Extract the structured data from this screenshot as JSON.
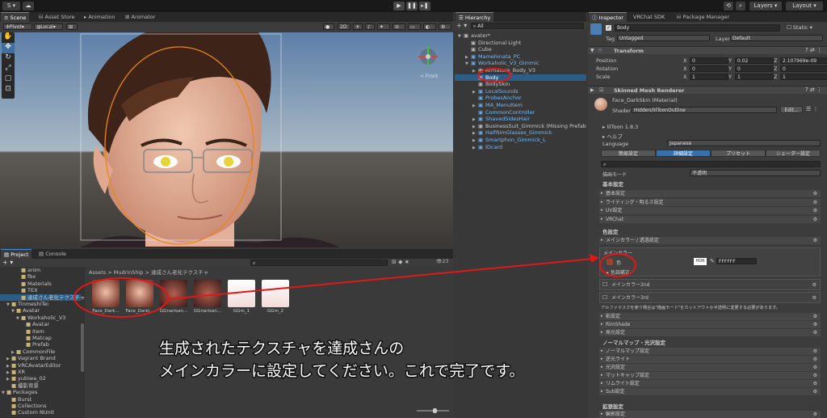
{
  "toolbar": {
    "account": "S",
    "layers": "Layers",
    "layout": "Layout"
  },
  "scene": {
    "tabs": [
      "Scene",
      "Asset Store",
      "Animation",
      "Animator"
    ],
    "pivot": "Pivot",
    "local": "Local",
    "mode2d": "2D",
    "front": "< Front"
  },
  "hierarchy": {
    "tab": "Hierarchy",
    "search": "All",
    "items": [
      {
        "label": "avater*",
        "indent": 0,
        "blue": false,
        "expand": "▼",
        "sel": false
      },
      {
        "label": "Directional Light",
        "indent": 1,
        "blue": false,
        "expand": "",
        "sel": false
      },
      {
        "label": "Cube",
        "indent": 1,
        "blue": false,
        "expand": "",
        "sel": false
      },
      {
        "label": "Mamehinata_PC",
        "indent": 1,
        "blue": true,
        "expand": "▶",
        "sel": false
      },
      {
        "label": "Workaholic_V3_Gimmic",
        "indent": 1,
        "blue": true,
        "expand": "▼",
        "sel": false
      },
      {
        "label": "Armature_Body_V3",
        "indent": 2,
        "blue": false,
        "expand": "▶",
        "sel": false
      },
      {
        "label": "Body",
        "indent": 2,
        "blue": false,
        "expand": "",
        "sel": true
      },
      {
        "label": "BodySkin",
        "indent": 2,
        "blue": false,
        "expand": "",
        "sel": false
      },
      {
        "label": "LocalSounds",
        "indent": 2,
        "blue": true,
        "expand": "▶",
        "sel": false
      },
      {
        "label": "ProbesAnchor",
        "indent": 2,
        "blue": true,
        "expand": "",
        "sel": false
      },
      {
        "label": "MA_MenuItem",
        "indent": 2,
        "blue": true,
        "expand": "▶",
        "sel": false
      },
      {
        "label": "CommonController",
        "indent": 2,
        "blue": true,
        "expand": "",
        "sel": false
      },
      {
        "label": "ShavedSidesHair",
        "indent": 2,
        "blue": true,
        "expand": "▶",
        "sel": false
      },
      {
        "label": "BusinessSuit_Gimmick (Missing Prefab",
        "indent": 2,
        "blue": false,
        "expand": "▶",
        "sel": false
      },
      {
        "label": "HalfRimGlasses_Gimmick",
        "indent": 2,
        "blue": true,
        "expand": "▶",
        "sel": false
      },
      {
        "label": "Smartphon_Gimmick_L",
        "indent": 2,
        "blue": true,
        "expand": "▶",
        "sel": false
      },
      {
        "label": "IDcard",
        "indent": 2,
        "blue": true,
        "expand": "▶",
        "sel": false
      }
    ]
  },
  "project": {
    "tabs": [
      "Project",
      "Console"
    ],
    "breadcrumb": [
      "Assets",
      "MudrinShip",
      "達成さん老化テクスチャ"
    ],
    "count": "23",
    "tree": [
      {
        "label": "anim",
        "indent": 3,
        "expand": ""
      },
      {
        "label": "fbx",
        "indent": 3,
        "expand": ""
      },
      {
        "label": "Materials",
        "indent": 3,
        "expand": ""
      },
      {
        "label": "TEX",
        "indent": 3,
        "expand": ""
      },
      {
        "label": "達成さん老化テクスチャ",
        "indent": 3,
        "expand": "",
        "sel": true
      },
      {
        "label": "TinmeshiTei",
        "indent": 1,
        "expand": "▼"
      },
      {
        "label": "Avatar",
        "indent": 2,
        "expand": "▼"
      },
      {
        "label": "Workaholic_V3",
        "indent": 3,
        "expand": "▼"
      },
      {
        "label": "Avatar",
        "indent": 4,
        "expand": ""
      },
      {
        "label": "Item",
        "indent": 4,
        "expand": ""
      },
      {
        "label": "Matcap",
        "indent": 4,
        "expand": ""
      },
      {
        "label": "Prefab",
        "indent": 4,
        "expand": ""
      },
      {
        "label": "CommonFile",
        "indent": 2,
        "expand": "▶"
      },
      {
        "label": "Vagrant Brand",
        "indent": 1,
        "expand": "▶"
      },
      {
        "label": "VRCAvatarEditor",
        "indent": 1,
        "expand": "▶"
      },
      {
        "label": "XR",
        "indent": 1,
        "expand": "▶"
      },
      {
        "label": "yubiwa_02",
        "indent": 1,
        "expand": "▶"
      },
      {
        "label": "撮影背景",
        "indent": 1,
        "expand": ""
      },
      {
        "label": "Packages",
        "indent": 0,
        "expand": "▼"
      },
      {
        "label": "Burst",
        "indent": 1,
        "expand": ""
      },
      {
        "label": "Collections",
        "indent": 1,
        "expand": ""
      },
      {
        "label": "Custom NUnit",
        "indent": 1,
        "expand": ""
      }
    ],
    "assets": [
      "Face_Dark...",
      "Face_Darki...",
      "GGnarisan...",
      "GGnarisan...",
      "GGm_1",
      "GGm_2"
    ]
  },
  "inspector": {
    "tabs": [
      "Inspector",
      "VRChat SDK",
      "Package Manager"
    ],
    "name": "Body",
    "static": "Static",
    "tag_label": "Tag",
    "tag": "Untagged",
    "layer_label": "Layer",
    "layer": "Default",
    "transform": {
      "title": "Transform",
      "rows": [
        {
          "label": "Position",
          "x": "0",
          "y": "0.02",
          "z": "2.107969e-09"
        },
        {
          "label": "Rotation",
          "x": "0",
          "y": "0",
          "z": "0"
        },
        {
          "label": "Scale",
          "x": "1",
          "y": "1",
          "z": "1"
        }
      ]
    },
    "smr": "Skinned Mesh Renderer",
    "material": "Face_DarkSkin (Material)",
    "shader_label": "Shader",
    "shader": "Hidden/lilToonOutline",
    "edit": "Edit...",
    "liltoon": "lilToon 1.8.3",
    "help": "ヘルプ",
    "language_label": "Language",
    "language": "Japanese",
    "modes": [
      "簡易設定",
      "詳細設定",
      "プリセット",
      "シェーダー設定"
    ],
    "render_label": "描画モード",
    "render": "不透明",
    "basic_header": "基本設定",
    "basic_items": [
      "基本設定",
      "ライティング・明るさ設定",
      "UV設定",
      "VRChat"
    ],
    "color_header": "色設定",
    "color_items": [
      "メインカラー / 透過設定"
    ],
    "main_color": "メインカラー",
    "color_label": "色",
    "hex": "FFFFFF",
    "hex_tag": "HDR",
    "correction": "色調補正",
    "main2": "メインカラー2nd",
    "main3": "メインカラー3rd",
    "alpha_note": "アルファマスクを使う場合は\"描画モード\"をカットアウトか半透明に変更する必要があります。",
    "more_items": [
      "影設定",
      "RimShade",
      "発光設定"
    ],
    "normal_header": "ノーマルマップ・光沢設定",
    "normal_items": [
      "ノーマルマップ設定",
      "逆光ライト",
      "光沢設定",
      "マットキャップ設定",
      "リムライト設定",
      "Sub設定"
    ],
    "ext_header": "拡張設定",
    "ext_items": [
      "輪郭設定"
    ]
  },
  "annotation": {
    "line1": "生成されたテクスチャを達成さんの",
    "line2": "メインカラーに設定してください。これで完了です。"
  }
}
